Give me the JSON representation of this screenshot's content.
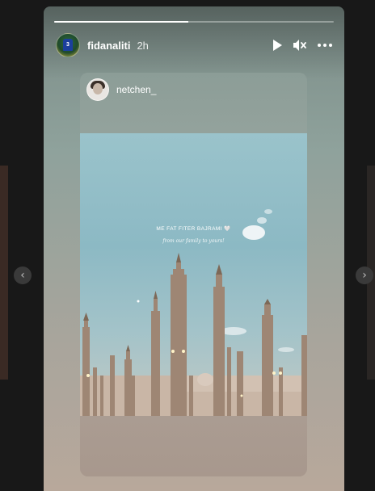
{
  "viewer": {
    "progress_fraction": 0.48,
    "account_username": "fidanaliti",
    "posted_ago": "2h",
    "avatar_jersey_number": "3",
    "controls": {
      "play_icon": "play-icon",
      "mute_icon": "mute-icon",
      "more_icon": "more-options-icon"
    },
    "prev_icon": "chevron-left-icon",
    "next_icon": "chevron-right-icon"
  },
  "reshared_post": {
    "username": "netchen_",
    "caption_main": "ME FAT FITER BAJRAMI 🤍",
    "caption_sub": "from our family to yours!"
  },
  "colors": {
    "background": "#181818",
    "text": "#ffffff"
  }
}
